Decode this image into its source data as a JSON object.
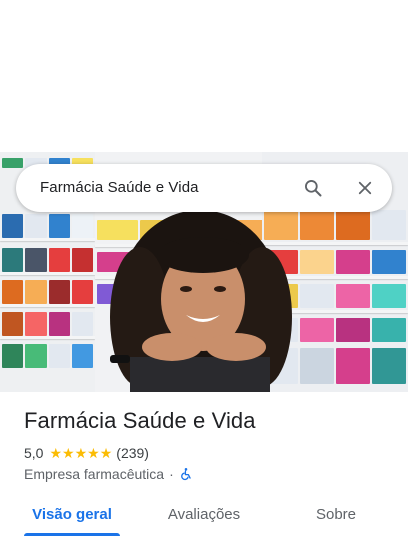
{
  "search": {
    "query": "Farmácia Saúde e Vida",
    "search_icon": "search-icon",
    "close_icon": "close-icon"
  },
  "place": {
    "name": "Farmácia Saúde e Vida",
    "rating_text": "5,0",
    "rating": 5.0,
    "stars_max": 5,
    "review_count": "(239)",
    "category": "Empresa farmacêutica",
    "separator": "·",
    "accessibility_icon": "wheelchair-icon"
  },
  "tabs": [
    {
      "label": "Visão geral",
      "active": true
    },
    {
      "label": "Avaliações",
      "active": false
    },
    {
      "label": "Sobre",
      "active": false
    }
  ],
  "colors": {
    "accent": "#1a73e8",
    "star": "#fbbc04",
    "text_primary": "#202124",
    "text_secondary": "#5f6368"
  }
}
